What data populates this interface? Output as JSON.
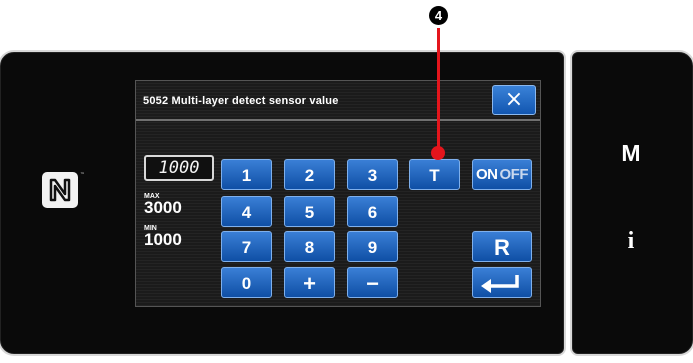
{
  "dialog": {
    "code": "5052",
    "title": "Multi-layer detect sensor value",
    "close_label": "×"
  },
  "entry": {
    "value": "1000",
    "max_label": "MAX",
    "max_value": "3000",
    "min_label": "MIN",
    "min_value": "1000"
  },
  "keypad": {
    "k1": "1",
    "k2": "2",
    "k3": "3",
    "k4": "4",
    "k5": "5",
    "k6": "6",
    "k7": "7",
    "k8": "8",
    "k9": "9",
    "k0": "0",
    "plus": "+",
    "minus": "−",
    "t": "T",
    "on": "ON",
    "off": "OFF",
    "r": "R"
  },
  "side": {
    "m_label": "M",
    "i_label": "i"
  },
  "callout": {
    "number": "4"
  },
  "nfc_tm": "™",
  "colors": {
    "key_blue": "#1a5fb8",
    "callout_red": "#e4151c",
    "panel": "#0a0a0a"
  },
  "icons": {
    "nfc": "nfc-n-mark-icon",
    "enter": "enter-return-icon",
    "close": "close-icon"
  }
}
